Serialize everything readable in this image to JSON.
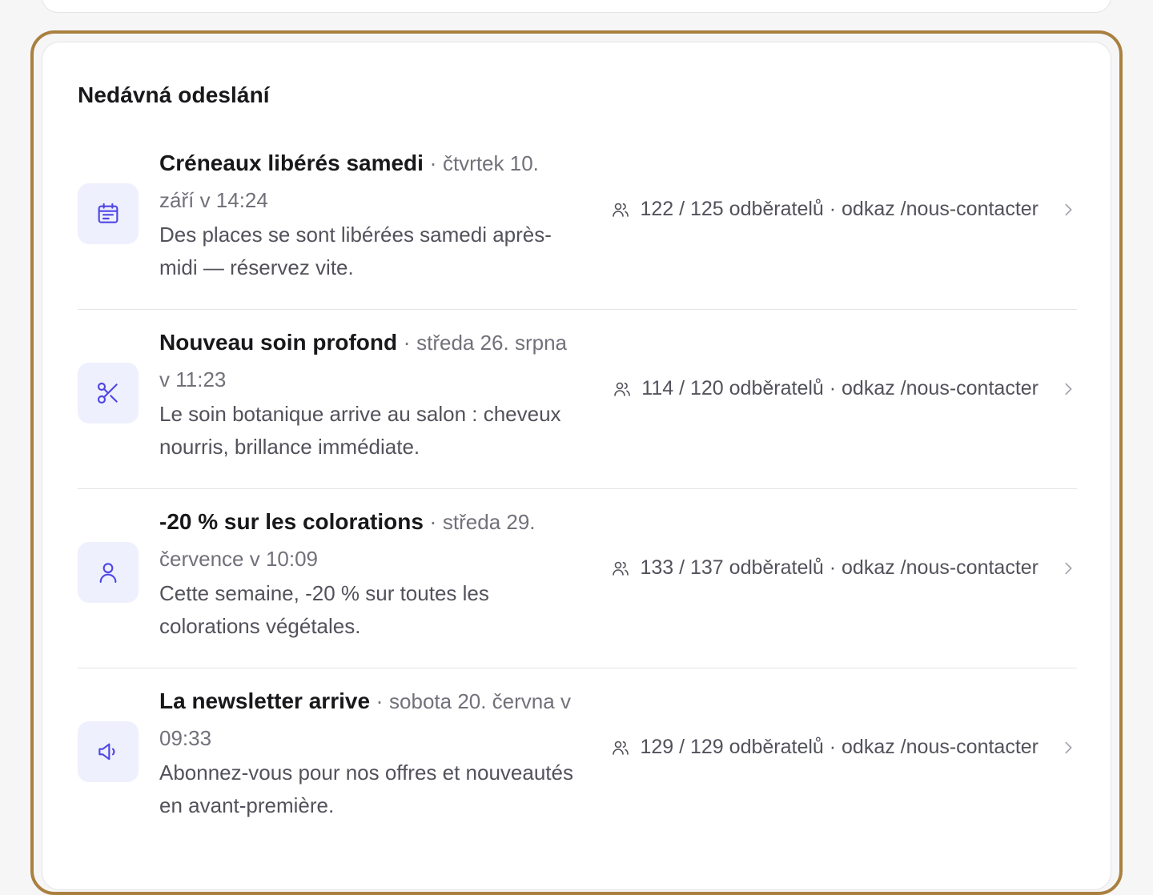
{
  "section": {
    "title": "Nedávná odeslání"
  },
  "sends": [
    {
      "title": "Créneaux libérés samedi",
      "separator": " · ",
      "date": "čtvrtek 10. září v 14:24",
      "description": "Des places se sont libérées samedi après-midi — réservez vite.",
      "icon": "calendar-icon",
      "recipients": "122 / 125 odběratelů · odkaz /nous-contacter"
    },
    {
      "title": "Nouveau soin profond",
      "separator": " · ",
      "date": "středa 26. srpna v 11:23",
      "description": "Le soin botanique arrive au salon : cheveux nourris, brillance immédiate.",
      "icon": "scissors-icon",
      "recipients": "114 / 120 odběratelů · odkaz /nous-contacter"
    },
    {
      "title": "-20 % sur les colorations",
      "separator": " · ",
      "date": "středa 29. července v 10:09",
      "description": "Cette semaine, -20 % sur toutes les colorations végétales.",
      "icon": "user-icon",
      "recipients": "133 / 137 odběratelů · odkaz /nous-contacter"
    },
    {
      "title": "La newsletter arrive",
      "separator": " · ",
      "date": "sobota 20. června v 09:33",
      "description": "Abonnez-vous pour nos offres et nouveautés en avant-première.",
      "icon": "megaphone-icon",
      "recipients": "129 / 129 odběratelů · odkaz /nous-contacter"
    }
  ],
  "colors": {
    "accent": "#4f46e5",
    "icon_tile_bg": "#eef0fd",
    "focus_ring": "#a9803f"
  }
}
